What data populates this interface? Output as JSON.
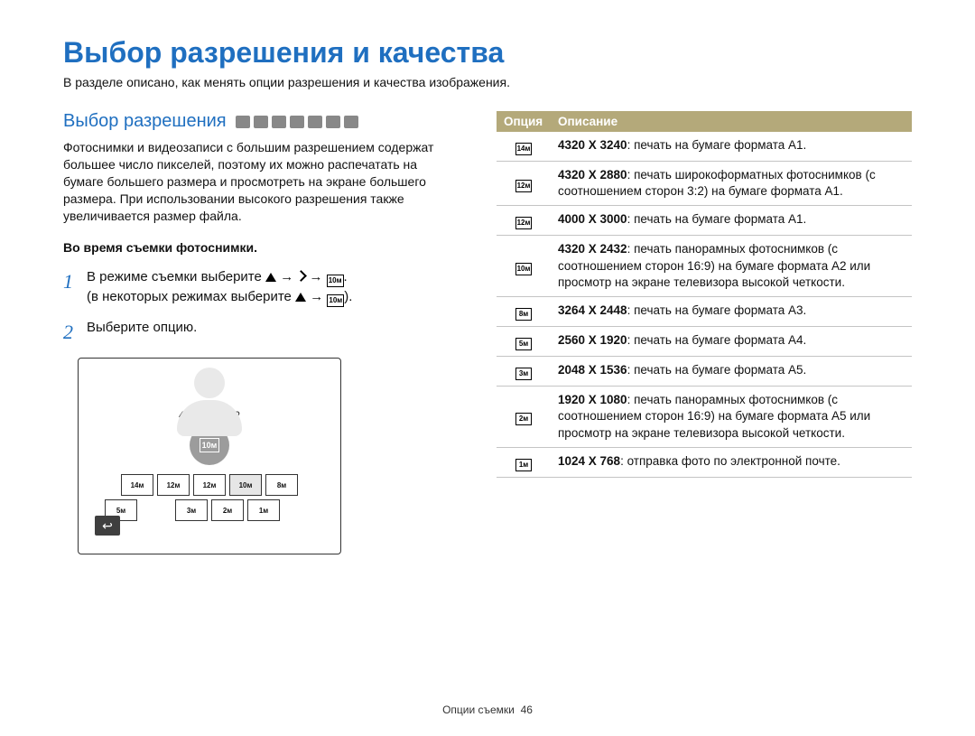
{
  "page": {
    "title": "Выбор разрешения и качества",
    "intro": "В разделе описано, как менять опции разрешения и качества изображения."
  },
  "section": {
    "title": "Выбор разрешения",
    "body": "Фотоснимки и видеозаписи с большим разрешением содержат большее число пикселей, поэтому их можно распечатать на бумаге большего размера и просмотреть на экране большего размера. При использовании высокого разрешения также увеличивается размер файла.",
    "note": "Во время съемки фотоснимки."
  },
  "steps": {
    "s1_a": "В режиме съемки выберите ",
    "s1_b": "(в некоторых режимах выберите ",
    "s1_icon_text": "10м",
    "s2": "Выберите опцию."
  },
  "inline_arrow": "→",
  "close_paren_dot": ").",
  "dot": ".",
  "lcd": {
    "label": "4320 X 2432",
    "big_icon": "10м",
    "buttons_row1": [
      "14м",
      "12м",
      "12м",
      "10м",
      "8м",
      "5м"
    ],
    "selected_index_row1": 3,
    "buttons_row2": [
      "3м",
      "2м",
      "1м"
    ]
  },
  "table": {
    "headers": {
      "option": "Опция",
      "desc": "Описание"
    },
    "rows": [
      {
        "icon": "14м",
        "res": "4320 X 3240",
        "text": ": печать на бумаге формата A1."
      },
      {
        "icon": "12м",
        "res": "4320 X 2880",
        "text": ": печать широкоформатных фотоснимков (с соотношением сторон 3:2) на бумаге формата A1."
      },
      {
        "icon": "12м",
        "res": "4000 X 3000",
        "text": ": печать на бумаге формата A1."
      },
      {
        "icon": "10м",
        "res": "4320 X 2432",
        "text": ": печать панорамных фотоснимков (с соотношением сторон 16:9) на бумаге формата A2 или просмотр на экране телевизора высокой четкости."
      },
      {
        "icon": "8м",
        "res": "3264 X 2448",
        "text": ": печать на бумаге формата A3."
      },
      {
        "icon": "5м",
        "res": "2560 X 1920",
        "text": ": печать на бумаге формата A4."
      },
      {
        "icon": "3м",
        "res": "2048 X 1536",
        "text": ": печать на бумаге формата A5."
      },
      {
        "icon": "2м",
        "res": "1920 X 1080",
        "text": ": печать панорамных фотоснимков (с соотношением сторон 16:9) на бумаге формата A5 или просмотр на экране телевизора высокой четкости."
      },
      {
        "icon": "1м",
        "res": "1024 X 768",
        "text": ": отправка фото по электронной почте."
      }
    ]
  },
  "footer": {
    "section": "Опции съемки",
    "page_num": "46"
  }
}
